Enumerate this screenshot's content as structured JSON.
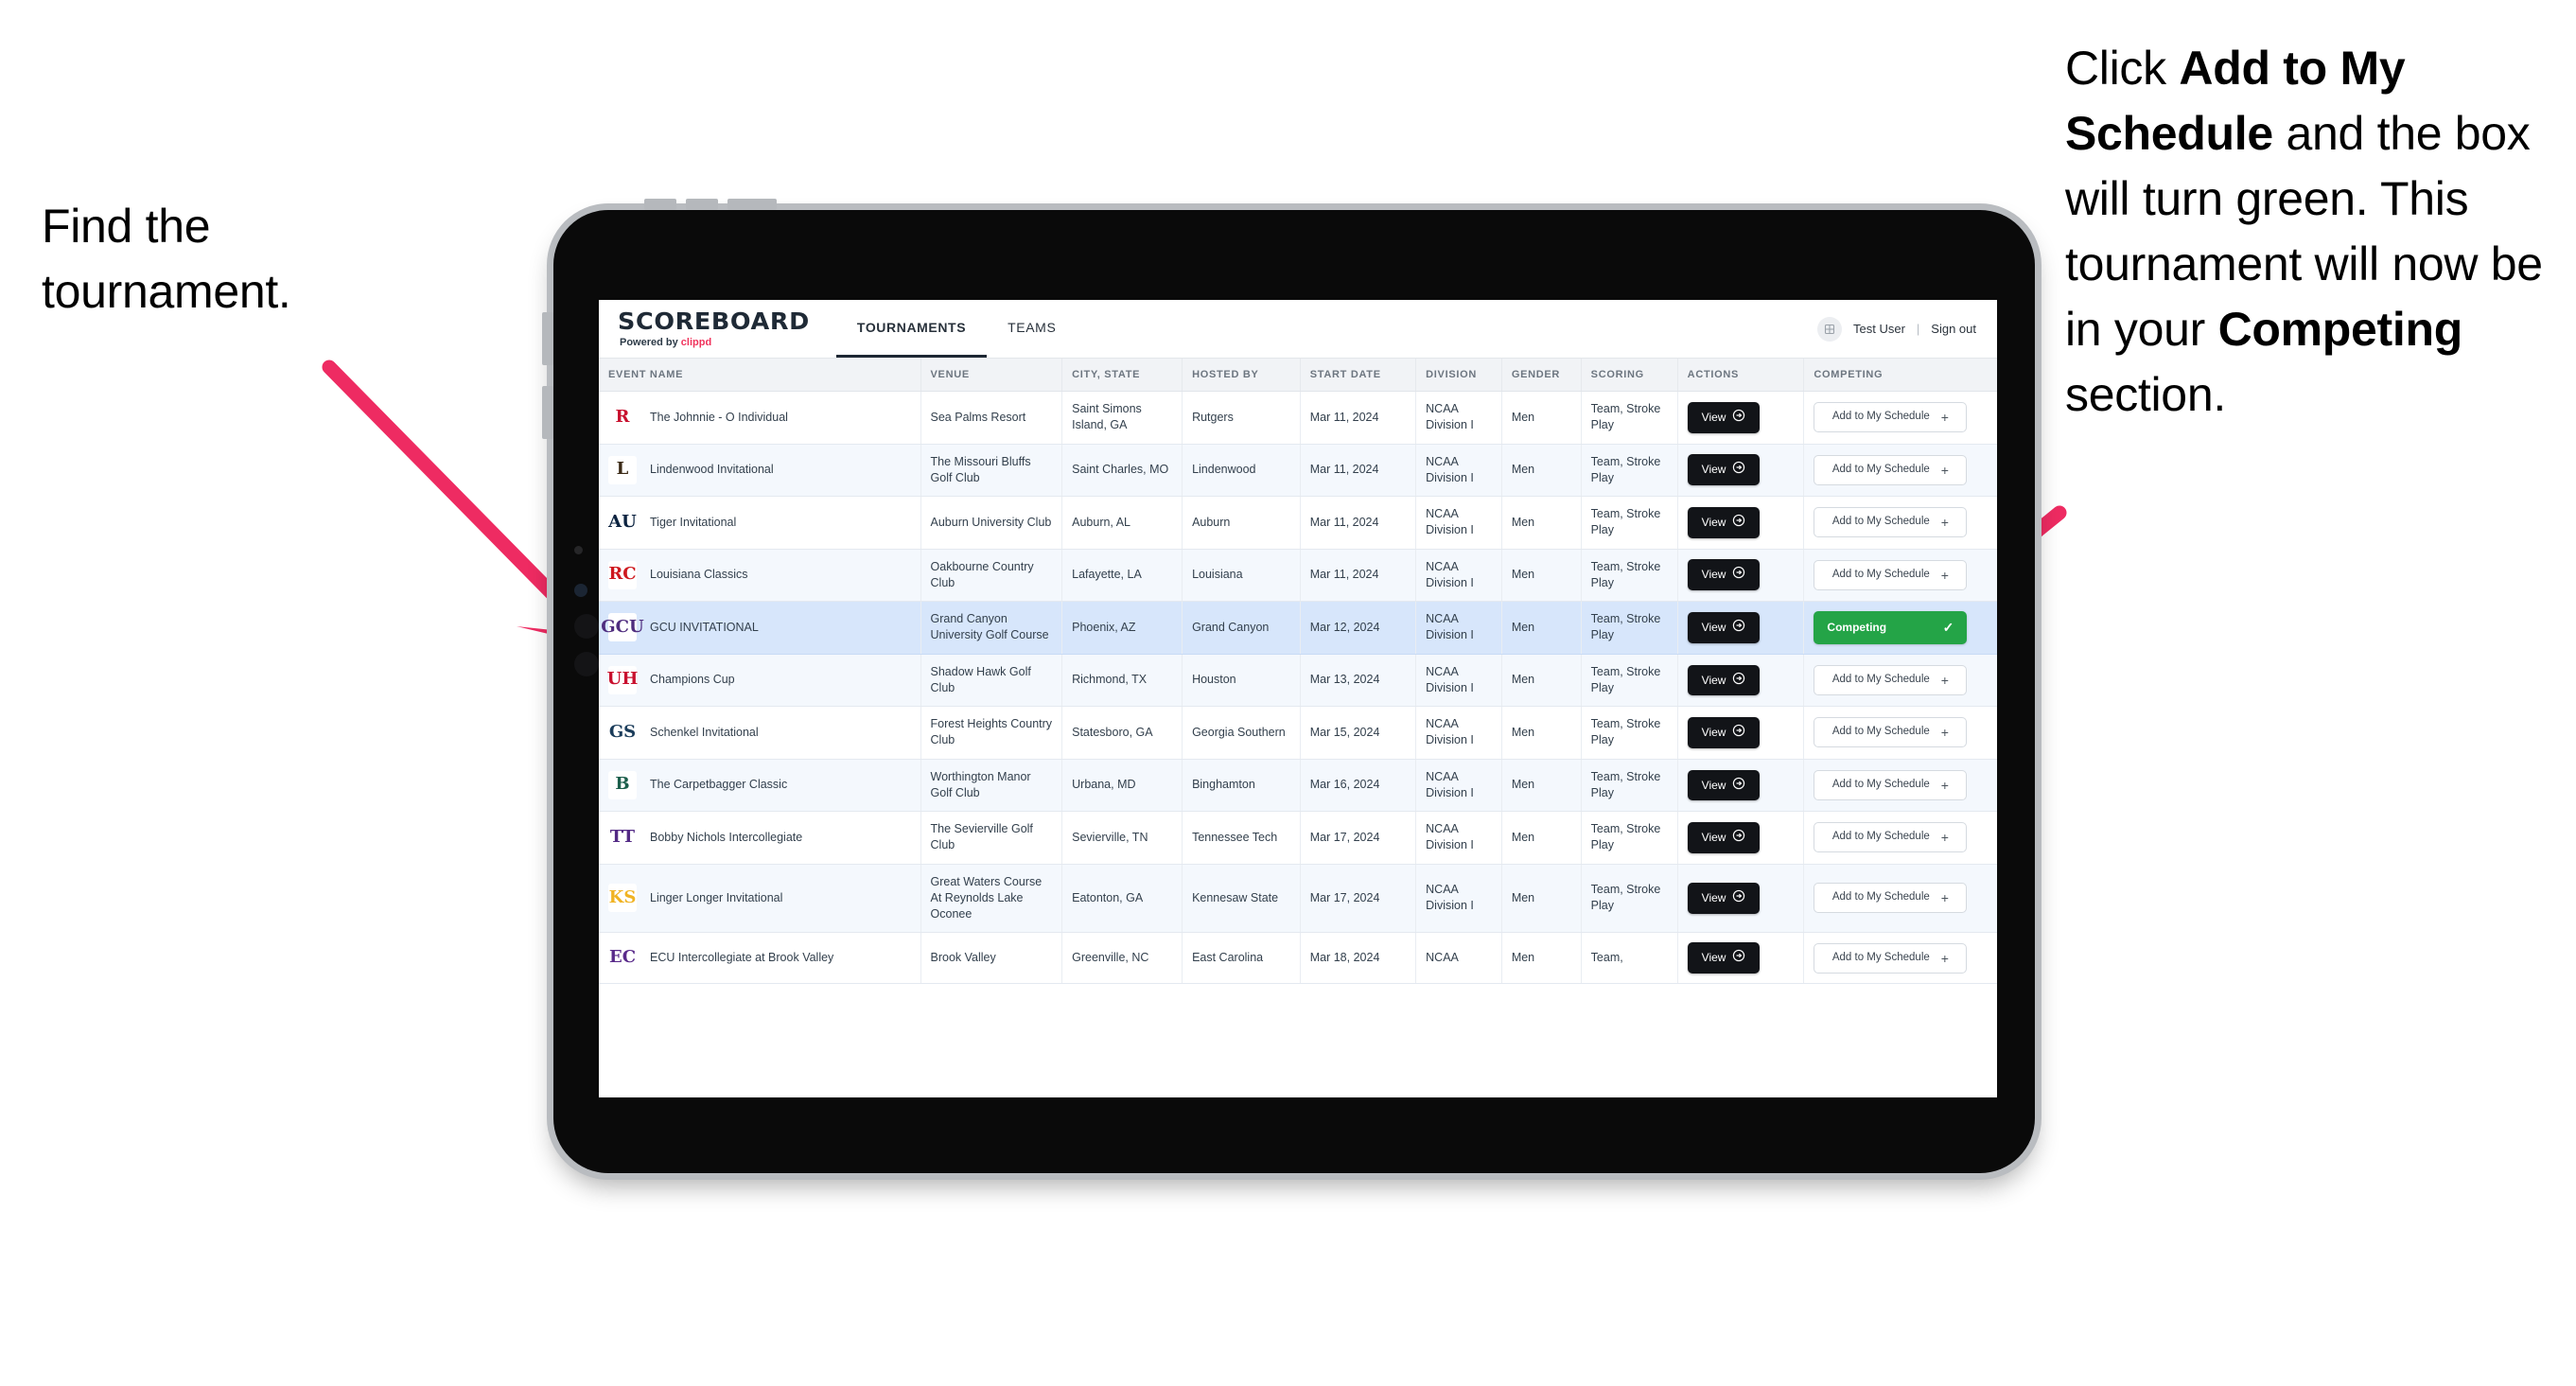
{
  "annotations": {
    "left": {
      "line1": "Find the",
      "line2": "tournament."
    },
    "right": {
      "seg1": "Click ",
      "bold1": "Add to My Schedule",
      "seg2": " and the box will turn green. This tournament will now be in your ",
      "bold2": "Competing",
      "seg3": " section."
    }
  },
  "app": {
    "brand": {
      "title": "SCOREBOARD",
      "powered_prefix": "Powered by ",
      "powered_brand": "clippd"
    },
    "tabs": [
      {
        "label": "TOURNAMENTS",
        "active": true
      },
      {
        "label": "TEAMS",
        "active": false
      }
    ],
    "user": {
      "avatar_icon": "user-avatar-icon",
      "name": "Test User",
      "separator": "|",
      "signout": "Sign out"
    }
  },
  "table": {
    "columns": [
      "EVENT NAME",
      "VENUE",
      "CITY, STATE",
      "HOSTED BY",
      "START DATE",
      "DIVISION",
      "GENDER",
      "SCORING",
      "ACTIONS",
      "COMPETING"
    ],
    "action_label": "View",
    "add_label": "Add to My Schedule",
    "add_icon": "plus-icon",
    "competing_label": "Competing",
    "competing_icon": "check-icon",
    "view_icon": "circle-arrow-right-icon",
    "rows": [
      {
        "logo_text": "R",
        "logo_color": "#c8102e",
        "logo_bg": "#ffffff",
        "name": "The Johnnie - O Individual",
        "venue": "Sea Palms Resort",
        "city": "Saint Simons Island, GA",
        "host": "Rutgers",
        "date": "Mar 11, 2024",
        "division": "NCAA Division I",
        "gender": "Men",
        "scoring": "Team, Stroke Play",
        "competing": false
      },
      {
        "logo_text": "L",
        "logo_color": "#3b2a16",
        "logo_bg": "#ffffff",
        "name": "Lindenwood Invitational",
        "venue": "The Missouri Bluffs Golf Club",
        "city": "Saint Charles, MO",
        "host": "Lindenwood",
        "date": "Mar 11, 2024",
        "division": "NCAA Division I",
        "gender": "Men",
        "scoring": "Team, Stroke Play",
        "competing": false
      },
      {
        "logo_text": "AU",
        "logo_color": "#0c2340",
        "logo_bg": "#ffffff",
        "name": "Tiger Invitational",
        "venue": "Auburn University Club",
        "city": "Auburn, AL",
        "host": "Auburn",
        "date": "Mar 11, 2024",
        "division": "NCAA Division I",
        "gender": "Men",
        "scoring": "Team, Stroke Play",
        "competing": false
      },
      {
        "logo_text": "RC",
        "logo_color": "#ce181e",
        "logo_bg": "#ffffff",
        "name": "Louisiana Classics",
        "venue": "Oakbourne Country Club",
        "city": "Lafayette, LA",
        "host": "Louisiana",
        "date": "Mar 11, 2024",
        "division": "NCAA Division I",
        "gender": "Men",
        "scoring": "Team, Stroke Play",
        "competing": false
      },
      {
        "logo_text": "GCU",
        "logo_color": "#4f2d7f",
        "logo_bg": "#ffffff",
        "name": "GCU INVITATIONAL",
        "venue": "Grand Canyon University Golf Course",
        "city": "Phoenix, AZ",
        "host": "Grand Canyon",
        "date": "Mar 12, 2024",
        "division": "NCAA Division I",
        "gender": "Men",
        "scoring": "Team, Stroke Play",
        "competing": true,
        "selected": true
      },
      {
        "logo_text": "UH",
        "logo_color": "#c8102e",
        "logo_bg": "#ffffff",
        "name": "Champions Cup",
        "venue": "Shadow Hawk Golf Club",
        "city": "Richmond, TX",
        "host": "Houston",
        "date": "Mar 13, 2024",
        "division": "NCAA Division I",
        "gender": "Men",
        "scoring": "Team, Stroke Play",
        "competing": false
      },
      {
        "logo_text": "GS",
        "logo_color": "#1a3c5a",
        "logo_bg": "#ffffff",
        "name": "Schenkel Invitational",
        "venue": "Forest Heights Country Club",
        "city": "Statesboro, GA",
        "host": "Georgia Southern",
        "date": "Mar 15, 2024",
        "division": "NCAA Division I",
        "gender": "Men",
        "scoring": "Team, Stroke Play",
        "competing": false
      },
      {
        "logo_text": "B",
        "logo_color": "#1b5e4b",
        "logo_bg": "#ffffff",
        "name": "The Carpetbagger Classic",
        "venue": "Worthington Manor Golf Club",
        "city": "Urbana, MD",
        "host": "Binghamton",
        "date": "Mar 16, 2024",
        "division": "NCAA Division I",
        "gender": "Men",
        "scoring": "Team, Stroke Play",
        "competing": false
      },
      {
        "logo_text": "TT",
        "logo_color": "#532a85",
        "logo_bg": "#ffffff",
        "name": "Bobby Nichols Intercollegiate",
        "venue": "The Sevierville Golf Club",
        "city": "Sevierville, TN",
        "host": "Tennessee Tech",
        "date": "Mar 17, 2024",
        "division": "NCAA Division I",
        "gender": "Men",
        "scoring": "Team, Stroke Play",
        "competing": false
      },
      {
        "logo_text": "KS",
        "logo_color": "#f0b323",
        "logo_bg": "#ffffff",
        "name": "Linger Longer Invitational",
        "venue": "Great Waters Course At Reynolds Lake Oconee",
        "city": "Eatonton, GA",
        "host": "Kennesaw State",
        "date": "Mar 17, 2024",
        "division": "NCAA Division I",
        "gender": "Men",
        "scoring": "Team, Stroke Play",
        "competing": false
      },
      {
        "logo_text": "EC",
        "logo_color": "#592a8a",
        "logo_bg": "#ffffff",
        "name": "ECU Intercollegiate at Brook Valley",
        "venue": "Brook Valley",
        "city": "Greenville, NC",
        "host": "East Carolina",
        "date": "Mar 18, 2024",
        "division": "NCAA",
        "gender": "Men",
        "scoring": "Team,",
        "competing": false
      }
    ]
  },
  "colors": {
    "arrow": "#ee2b62",
    "competing_green": "#24a447",
    "selected_row": "#d7e6fb",
    "brand_pink": "#f0335c"
  }
}
